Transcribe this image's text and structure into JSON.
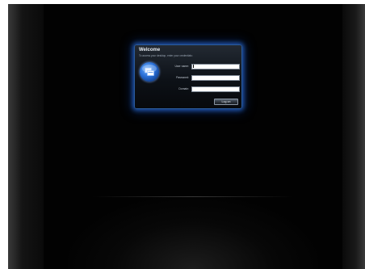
{
  "login": {
    "title": "Welcome",
    "subtitle": "To access your desktop, enter your credentials:",
    "fields": {
      "username": {
        "label": "User name:",
        "value": ""
      },
      "password": {
        "label": "Password:",
        "value": ""
      },
      "domain": {
        "label": "Domain:",
        "value": ""
      }
    },
    "button_label": "Log on"
  },
  "icons": {
    "logo": "windows-server-logo-icon"
  },
  "colors": {
    "desktop_background": "#020202",
    "dialog_glow": "#2b5a9a",
    "logo_blue": "#2a6fd6"
  }
}
